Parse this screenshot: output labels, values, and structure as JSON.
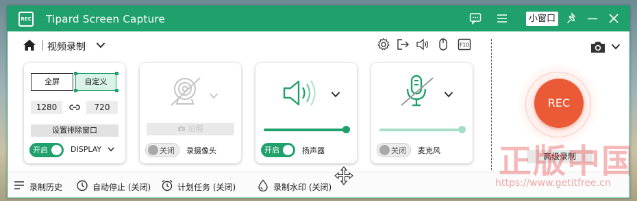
{
  "window": {
    "app_title": "Tipard Screen Capture",
    "logo_text": "REC",
    "mini_window_label": "小窗口"
  },
  "header": {
    "mode_label": "视频录制"
  },
  "display_panel": {
    "full_screen_label": "全屏",
    "custom_label": "自定义",
    "width_value": "1280",
    "height_value": "720",
    "exclude_window_label": "设置排除窗口",
    "toggle_label": "开启",
    "display_label": "DISPLAY"
  },
  "webcam_panel": {
    "photo_label": "拍照",
    "toggle_label": "关闭",
    "label": "录摄像头"
  },
  "speaker_panel": {
    "toggle_label": "开启",
    "label": "扬声器",
    "volume": 1.0
  },
  "mic_panel": {
    "toggle_label": "关闭",
    "label": "麦克风",
    "volume": 1.0
  },
  "rec": {
    "button_label": "REC",
    "advanced_label": "高级录制"
  },
  "bottom_bar": {
    "history_label": "录制历史",
    "auto_stop_label": "自动停止 (关闭)",
    "schedule_label": "计划任务 (关闭)",
    "watermark_label": "录制水印 (关闭)"
  },
  "overlay_watermark": {
    "text": "正版中国",
    "url": "https://www.getitfree.cn"
  },
  "colors": {
    "brand_green": "#20a06c",
    "rec_red": "#eb5a36"
  }
}
